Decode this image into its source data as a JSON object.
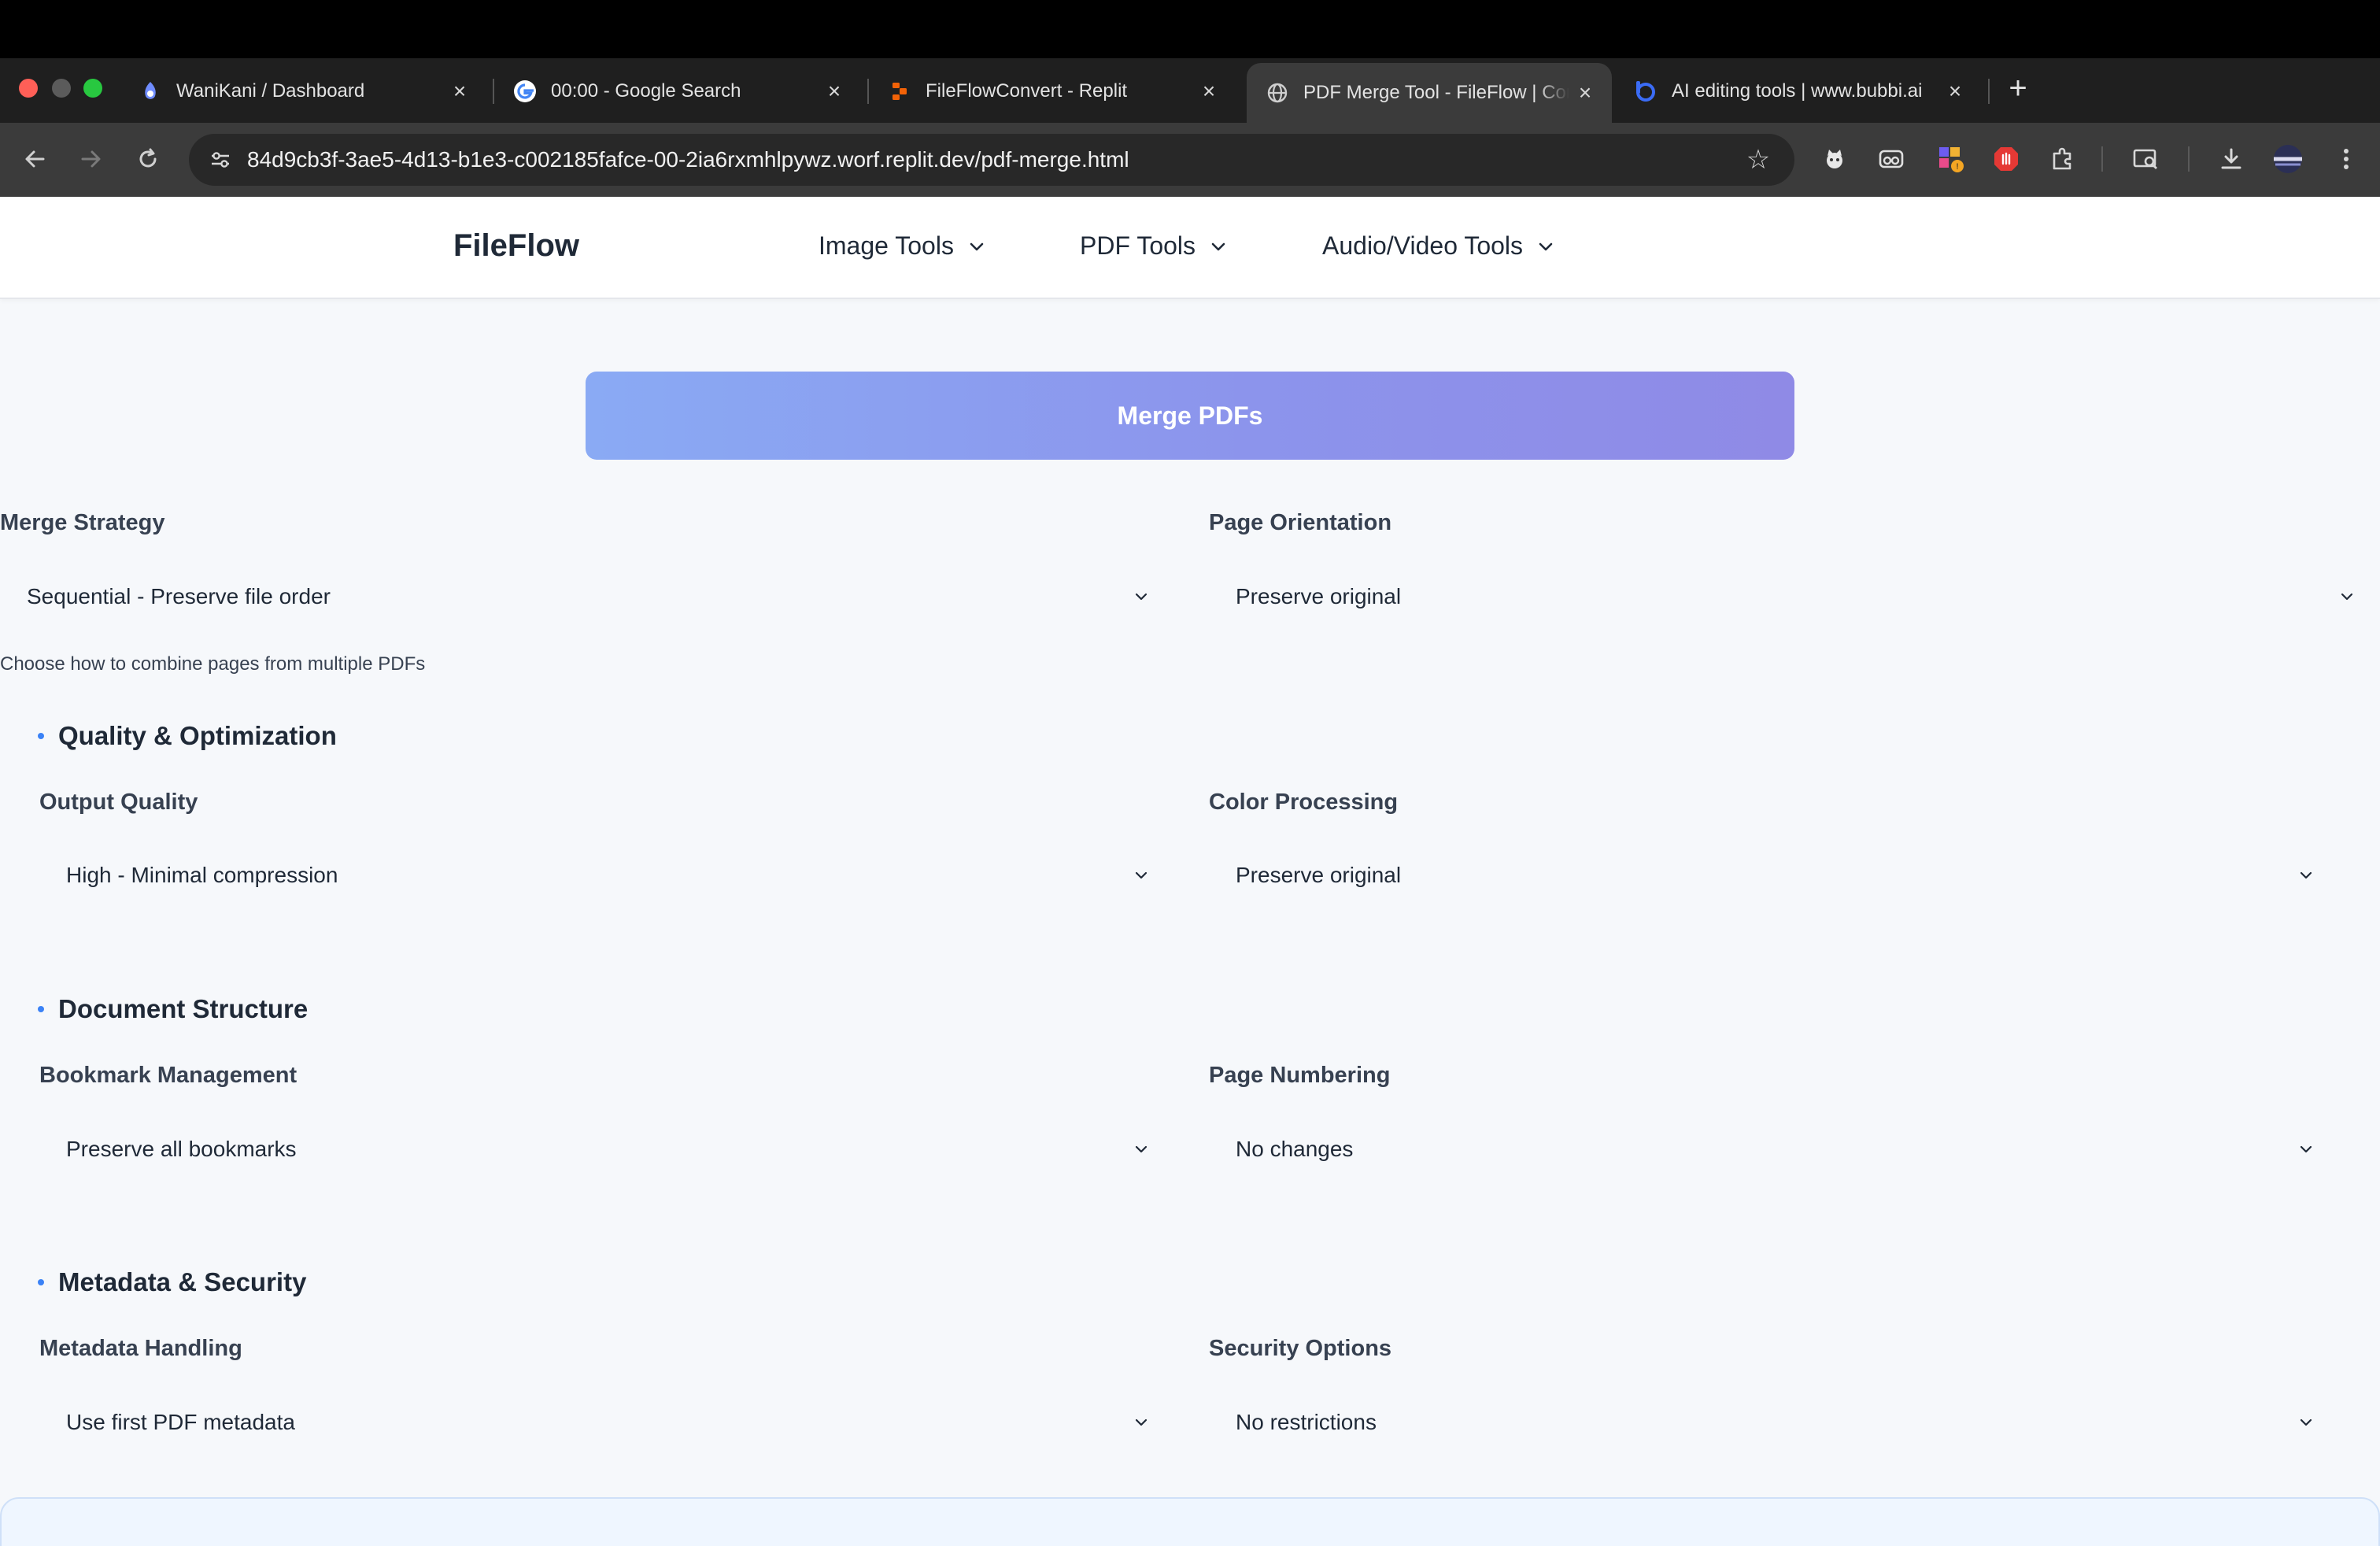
{
  "browser": {
    "tabs": [
      {
        "title": "WaniKani / Dashboard",
        "icon": "wanikani-icon",
        "active": false
      },
      {
        "title": "00:00 - Google Search",
        "icon": "google-icon",
        "active": false
      },
      {
        "title": "FileFlowConvert - Replit",
        "icon": "replit-icon",
        "active": false
      },
      {
        "title": "PDF Merge Tool - FileFlow | Convert",
        "icon": "globe-icon",
        "active": true
      },
      {
        "title": "AI editing tools | www.bubbi.ai",
        "icon": "bubbi-icon",
        "active": false
      }
    ],
    "url": "84d9cb3f-3ae5-4d13-b1e3-c002185fafce-00-2ia6rxmhlpywz.worf.replit.dev/pdf-merge.html"
  },
  "site": {
    "brand": "FileFlow",
    "nav": [
      {
        "label": "Image Tools"
      },
      {
        "label": "PDF Tools"
      },
      {
        "label": "Audio/Video Tools"
      }
    ]
  },
  "main": {
    "merge_button": "Merge PDFs",
    "merge_strategy": {
      "label": "Merge Strategy",
      "value": "Sequential - Preserve file order",
      "hint": "Choose how to combine pages from multiple PDFs"
    },
    "page_orientation": {
      "label": "Page Orientation",
      "value": "Preserve original"
    },
    "sections": {
      "quality": {
        "title": "Quality & Optimization",
        "output_quality": {
          "label": "Output Quality",
          "value": "High - Minimal compression"
        },
        "color_processing": {
          "label": "Color Processing",
          "value": "Preserve original"
        }
      },
      "structure": {
        "title": "Document Structure",
        "bookmarks": {
          "label": "Bookmark Management",
          "value": "Preserve all bookmarks"
        },
        "page_numbering": {
          "label": "Page Numbering",
          "value": "No changes"
        }
      },
      "metadata": {
        "title": "Metadata & Security",
        "metadata_handling": {
          "label": "Metadata Handling",
          "value": "Use first PDF metadata"
        },
        "security": {
          "label": "Security Options",
          "value": "No restrictions"
        }
      }
    }
  },
  "colors": {
    "accent": "#3b82f6",
    "button_gradient_start": "#8aaaf4",
    "button_gradient_end": "#8f8ae6",
    "page_bg": "#f6f8fb"
  }
}
